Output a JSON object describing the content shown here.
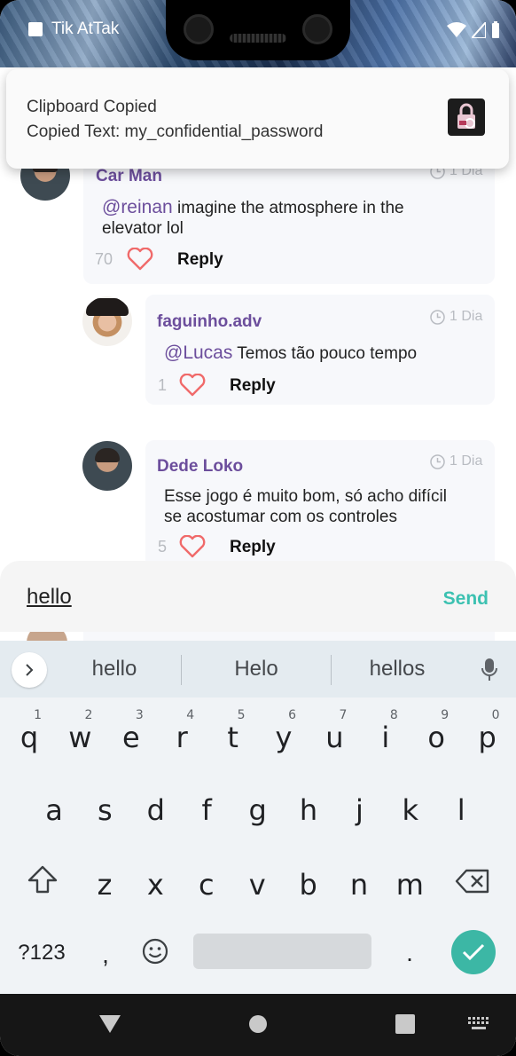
{
  "status_bar": {
    "app_name": "Tik AtTak"
  },
  "notification": {
    "title": "Clipboard Copied",
    "body": "Copied Text: my_confidential_password",
    "icon": "lock-icon"
  },
  "comments": [
    {
      "author": "Car Man",
      "time": "1 Dia",
      "mention": "@reinan",
      "text": "imagine the atmosphere in the",
      "text2": "elevator lol",
      "likes": "70",
      "reply_label": "Reply"
    },
    {
      "author": "faguinho.adv",
      "time": "1 Dia",
      "mention": "@Lucas",
      "text": "Temos tão pouco tempo",
      "likes": "1",
      "reply_label": "Reply"
    },
    {
      "author": "Dede Loko",
      "time": "1 Dia",
      "text": "Esse jogo é muito bom, só acho difícil",
      "text2": "se acostumar com os controles",
      "likes": "5",
      "reply_label": "Reply"
    }
  ],
  "input": {
    "value": "hello",
    "send_label": "Send"
  },
  "keyboard": {
    "suggestions": [
      "hello",
      "Helo",
      "hellos"
    ],
    "row1": [
      "q",
      "w",
      "e",
      "r",
      "t",
      "y",
      "u",
      "i",
      "o",
      "p"
    ],
    "row1_numbers": [
      "1",
      "2",
      "3",
      "4",
      "5",
      "6",
      "7",
      "8",
      "9",
      "0"
    ],
    "row2": [
      "a",
      "s",
      "d",
      "f",
      "g",
      "h",
      "j",
      "k",
      "l"
    ],
    "row3": [
      "z",
      "x",
      "c",
      "v",
      "b",
      "n",
      "m"
    ],
    "symbols_label": "?123",
    "comma": ",",
    "period": "."
  },
  "colors": {
    "accent": "#3cc1b1",
    "username": "#6c4e9c",
    "heart": "#f06a6a"
  }
}
